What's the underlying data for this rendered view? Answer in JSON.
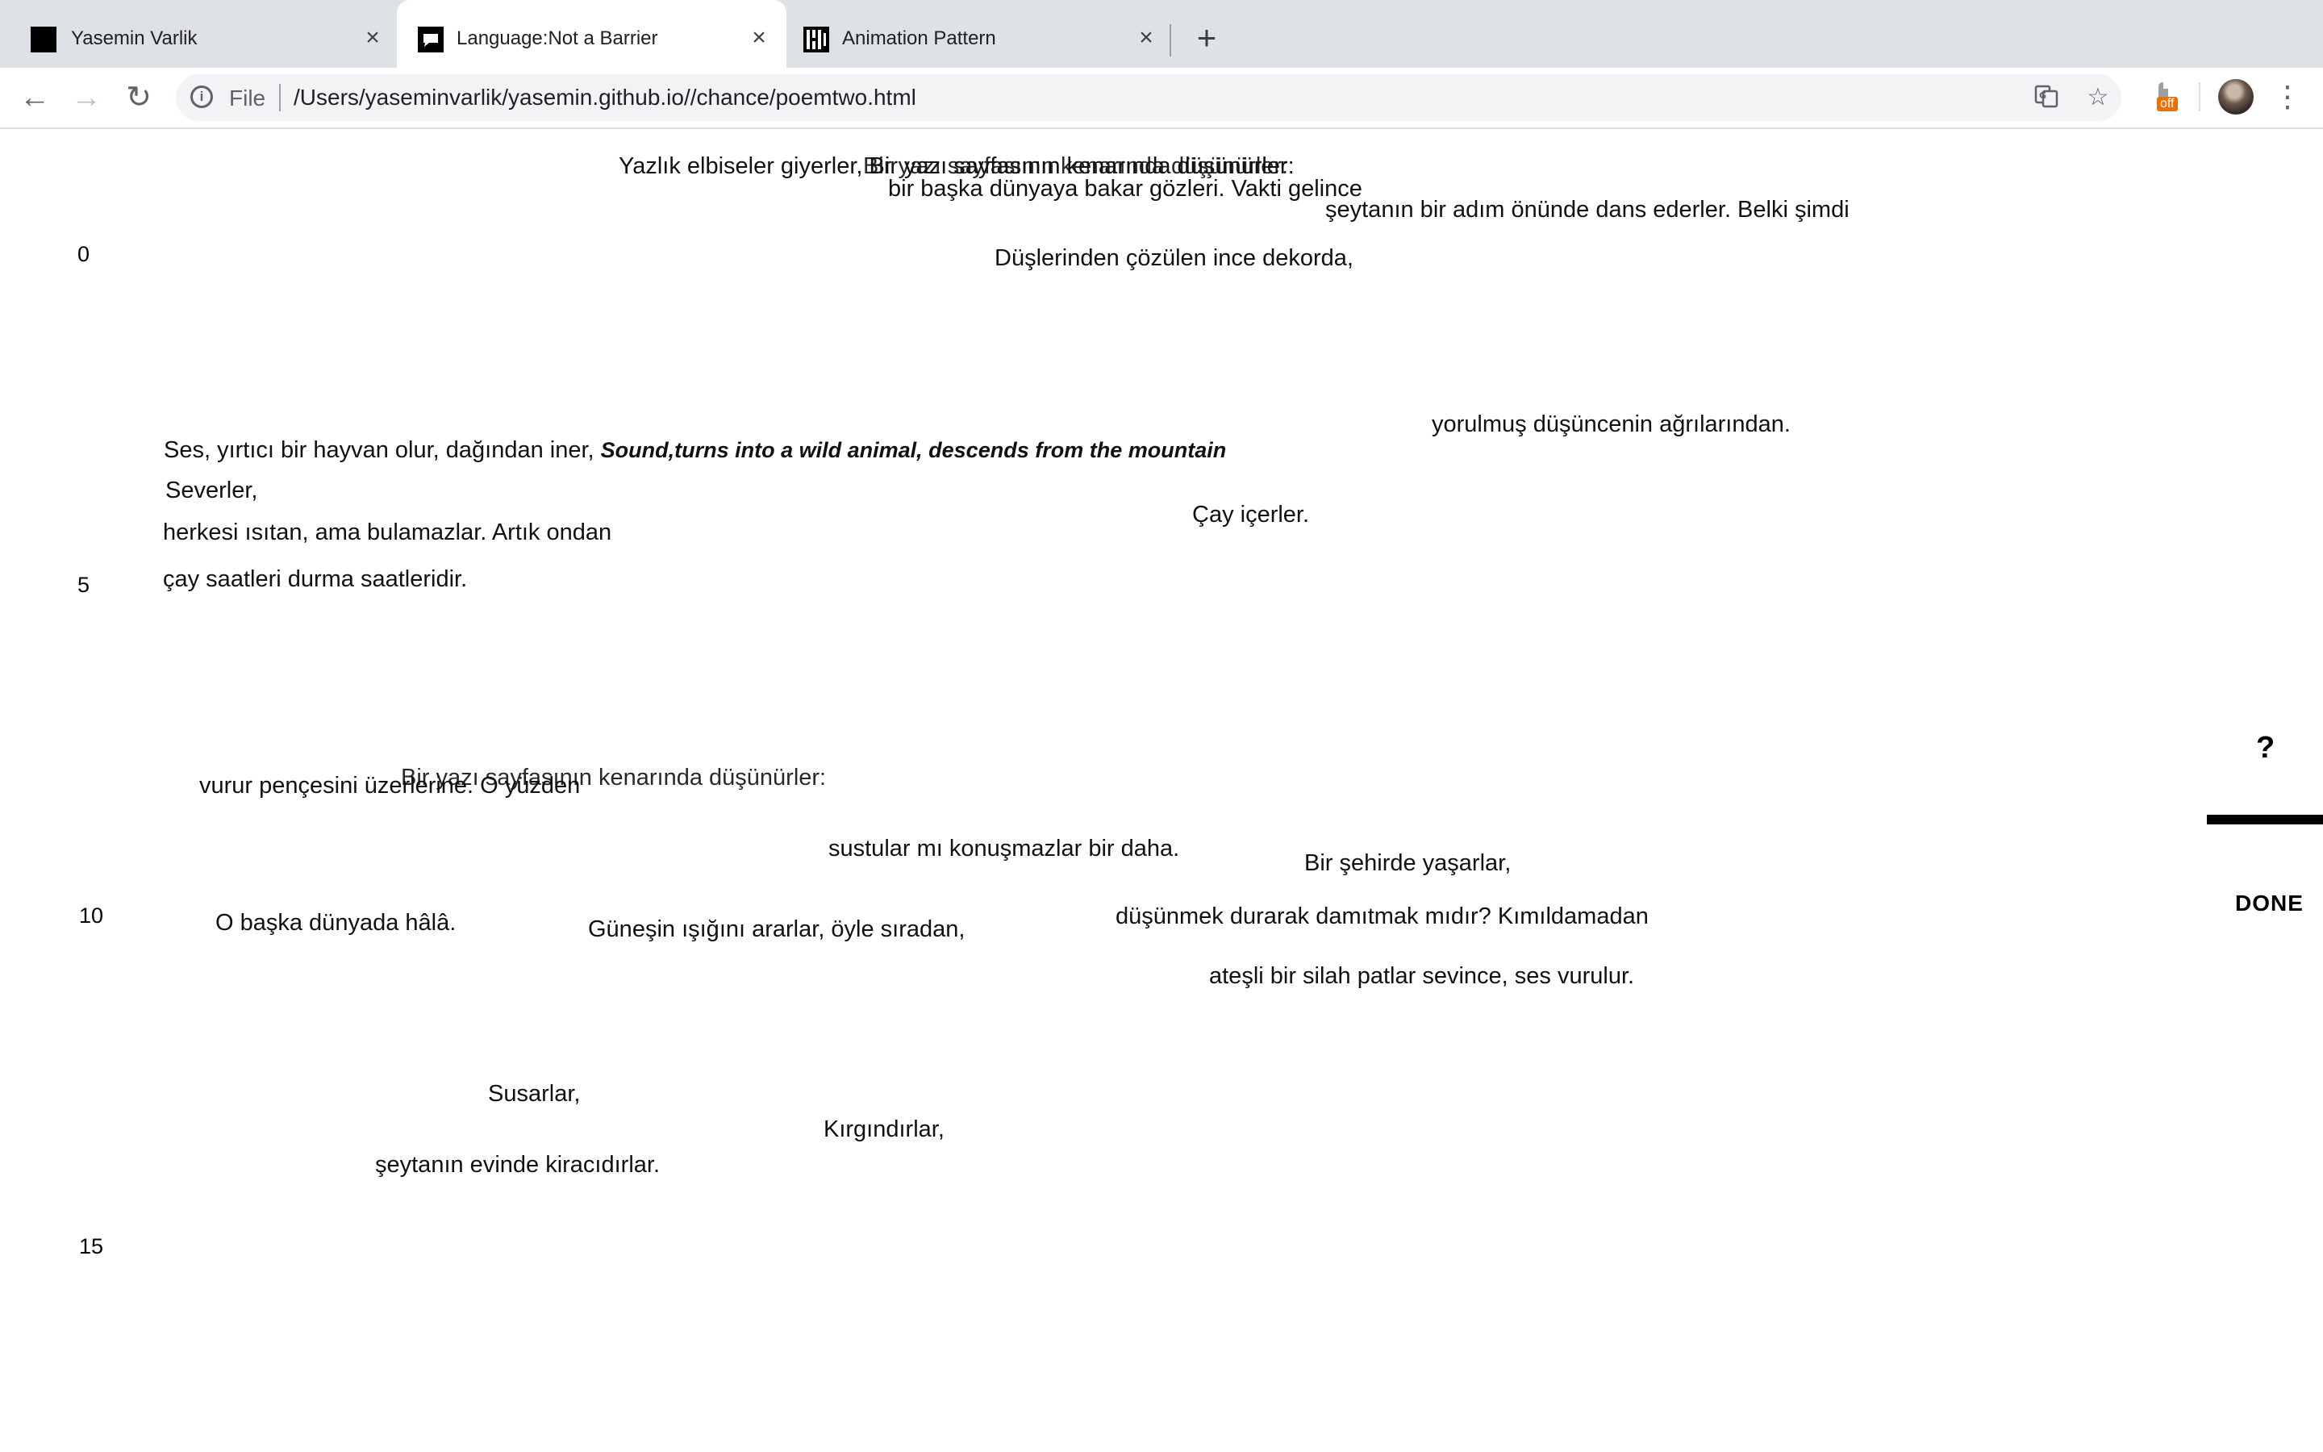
{
  "browser": {
    "tabs": [
      {
        "title": "Yasemin Varlik",
        "favicon": "black-square-icon",
        "active": false
      },
      {
        "title": "Language:Not a Barrier",
        "favicon": "speech-bubble-icon",
        "active": true
      },
      {
        "title": "Animation Pattern",
        "favicon": "pattern-icon",
        "active": false
      }
    ],
    "close_glyph": "×",
    "new_tab_glyph": "+",
    "address": {
      "scheme_label": "File",
      "url": "/Users/yaseminvarlik/yasemin.github.io//chance/poemtwo.html"
    },
    "extension_badge": "off"
  },
  "page": {
    "line_numbers": [
      "0",
      "5",
      "10",
      "15"
    ],
    "poem_lines": [
      {
        "id": "l01",
        "text": "Yazlık elbiseler giyerler, Bir yazı sayfasının kenarında düşünürler:"
      },
      {
        "id": "l02",
        "text": "Bir yazı sayfasının kenarında düşünürler:"
      },
      {
        "id": "l03",
        "text": "bir başka dünyaya bakar gözleri. Vakti gelince"
      },
      {
        "id": "l04",
        "text": "şeytanın bir adım önünde dans ederler. Belki şimdi"
      },
      {
        "id": "l05",
        "text": "Düşlerinden çözülen ince dekorda,"
      },
      {
        "id": "l06",
        "text": "yorulmuş düşüncenin ağrılarından."
      },
      {
        "id": "l07",
        "text": "Ses, yırtıcı bir hayvan olur, dağından iner, ",
        "en": "Sound,turns into a wild animal, descends from the mountain"
      },
      {
        "id": "l08",
        "text": "Severler,"
      },
      {
        "id": "l09",
        "text": "herkesi ısıtan, ama bulamazlar. Artık ondan"
      },
      {
        "id": "l10",
        "text": "Çay içerler."
      },
      {
        "id": "l11",
        "text": "çay saatleri durma saatleridir."
      },
      {
        "id": "l12",
        "text": "vurur pençesini üzerlerine. O yüzden"
      },
      {
        "id": "l13",
        "text": "Bir yazı sayfasının kenarında düşünürler:"
      },
      {
        "id": "l14",
        "text": "sustular mı konuşmazlar bir daha."
      },
      {
        "id": "l15",
        "text": "Bir şehirde yaşarlar,"
      },
      {
        "id": "l16",
        "text": "O başka dünyada hâlâ."
      },
      {
        "id": "l17",
        "text": "Güneşin ışığını ararlar, öyle sıradan,"
      },
      {
        "id": "l18",
        "text": "düşünmek durarak damıtmak mıdır? Kımıldamadan"
      },
      {
        "id": "l19",
        "text": "ateşli bir silah patlar sevince, ses vurulur."
      },
      {
        "id": "l20",
        "text": "Susarlar,"
      },
      {
        "id": "l21",
        "text": "Kırgındırlar,"
      },
      {
        "id": "l22",
        "text": "şeytanın evinde kiracıdırlar."
      }
    ],
    "help_label": "?",
    "done_label": "DONE"
  }
}
